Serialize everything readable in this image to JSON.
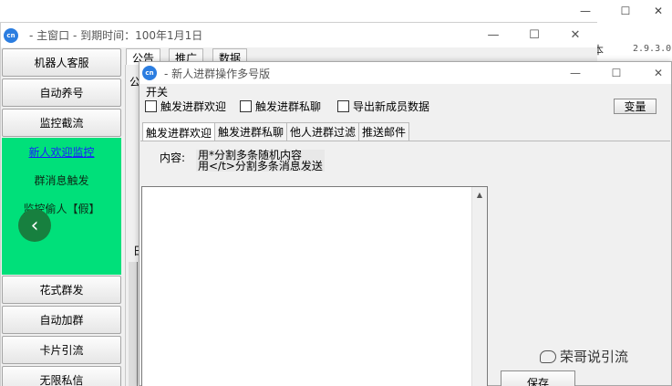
{
  "background_window": {
    "right_label": "本",
    "right_version": "2.9.3.0"
  },
  "main_window": {
    "title": "- 主窗口 -  到期时间：100年1月1日",
    "app_icon_text": "cn",
    "sidebar": {
      "top_buttons": [
        "机器人客服",
        "自动养号",
        "监控截流"
      ],
      "green_items": [
        "新人欢迎监控",
        "群消息触发",
        "监控偷人【假】"
      ],
      "bottom_buttons": [
        "花式群发",
        "自动加群",
        "卡片引流",
        "无限私信"
      ]
    },
    "tabs": [
      "公告",
      "推广",
      "数据"
    ],
    "content_peek": "公",
    "side_peek": "日"
  },
  "dialog": {
    "title": "- 新人进群操作多号版",
    "app_icon_text": "cn",
    "menu_label": "开关",
    "checkboxes": [
      "触发进群欢迎",
      "触发进群私聊",
      "导出新成员数据"
    ],
    "change_button": "变量",
    "tabs": [
      "触发进群欢迎",
      "触发进群私聊",
      "他人进群过滤",
      "推送邮件"
    ],
    "content_label": "内容:",
    "hint_line1": "用*分割多条随机内容",
    "hint_line2": "用</t>分割多条消息发送",
    "save_button": "保存"
  },
  "watermark": "荣哥说引流"
}
